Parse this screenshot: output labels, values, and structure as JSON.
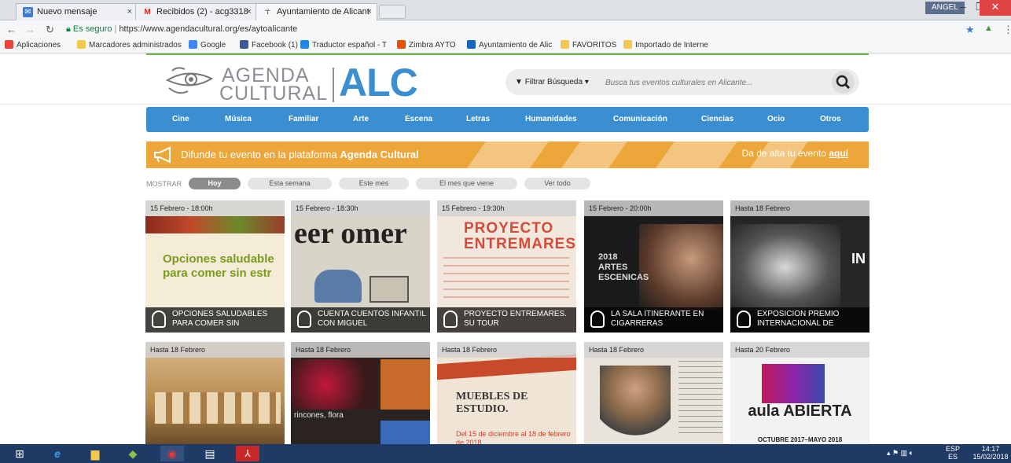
{
  "browser": {
    "tabs": [
      {
        "label": "Nuevo mensaje",
        "icon": "compose-icon",
        "close": "×"
      },
      {
        "label": "Recibidos (2) - acg3318",
        "icon": "gmail-icon",
        "close": "×"
      },
      {
        "label": "Ayuntamiento de Alicant",
        "icon": "alc-icon",
        "close": "×"
      }
    ],
    "user": "ANGEL",
    "secure_label": "Es seguro",
    "url": "https://www.agendacultural.org/es/aytoalicante",
    "bookmarks": [
      {
        "label": "Aplicaciones",
        "color": "#e8443a"
      },
      {
        "label": "Marcadores administrados",
        "color": "#f2c94c"
      },
      {
        "label": "Google",
        "color": "#4285f4"
      },
      {
        "label": "Facebook (1)",
        "color": "#3b5998"
      },
      {
        "label": "Traductor español - T",
        "color": "#1e88e5"
      },
      {
        "label": "Zimbra AYTO",
        "color": "#e65100"
      },
      {
        "label": "Ayuntamiento de Alic",
        "color": "#1565c0"
      },
      {
        "label": "FAVORITOS",
        "color": "#f2c94c"
      },
      {
        "label": "Importado de Interne",
        "color": "#f2c94c"
      }
    ]
  },
  "site": {
    "logo": {
      "agenda": "AGENDA",
      "cultural": "CULTURAL",
      "alc": "ALC"
    },
    "filter_label": "Filtrar Búsqueda",
    "search_placeholder": "Busca tus eventos culturales en Alicante...",
    "menu": [
      "Cine",
      "Música",
      "Familiar",
      "Arte",
      "Escena",
      "Letras",
      "Humanidades",
      "Comunicación",
      "Ciencias",
      "Ocio",
      "Otros"
    ],
    "banner": {
      "text": "Difunde tu evento en la plataforma ",
      "bold": "Agenda Cultural",
      "cta": "Da de alta tu evento ",
      "cta_link": "aquí"
    },
    "mostrar": "MOSTRAR",
    "filters": [
      "Hoy",
      "Esta semana",
      "Este mes",
      "El mes que viene",
      "Ver todo"
    ],
    "row1": [
      {
        "date": "15 Febrero - 18:00h",
        "title": "OPCIONES SALUDABLES PARA COMER SIN",
        "img_text": "Opciones saludable para comer sin estr",
        "bg": "#f4ecd6"
      },
      {
        "date": "15 Febrero - 18:30h",
        "title": "CUENTA CUENTOS INFANTIL CON MIGUEL",
        "img_text": "eer omer",
        "bg": "#d9d4c8"
      },
      {
        "date": "15 Febrero - 19:30h",
        "title": "PROYECTO ENTREMARES. SU TOUR",
        "img_text": "PROYECTO ENTREMARES",
        "bg": "#f1e7dc"
      },
      {
        "date": "15 Febrero - 20:00h",
        "title": "LA SALA ITINERANTE EN CIGARRERAS",
        "img_text": "2018 ARTES ESCENICAS",
        "bg": "#1b1b1b"
      },
      {
        "date": "Hasta 18 Febrero",
        "title": "EXPOSICIÓN PREMIO INTERNACIONAL DE",
        "img_text": "IN",
        "bg": "#262626"
      }
    ],
    "row2": [
      {
        "date": "Hasta 18 Febrero",
        "bg": "#b68a4e"
      },
      {
        "date": "Hasta 18 Febrero",
        "img_text": "rincones, flora",
        "bg": "#2a2320"
      },
      {
        "date": "Hasta 18 Febrero",
        "img_text": "MUEBLES DE ESTUDIO.",
        "sub": "Del 15 de diciembre al 18 de febrero de 2018",
        "bg": "#efe4d6"
      },
      {
        "date": "Hasta 18 Febrero",
        "bg": "#e8e4dc"
      },
      {
        "date": "Hasta 20 Febrero",
        "img_text": "aula ABIERTA",
        "sub": "OCTUBRE 2017–MAYO 2018",
        "bg": "#f2f2f0"
      }
    ]
  },
  "taskbar": {
    "lang": "ESP",
    "lang2": "ES",
    "time": "14:17",
    "date": "15/02/2018"
  },
  "colors": {
    "brand_blue": "#3b8fd1",
    "banner": "#eda63a",
    "taskbar": "#1f3a64"
  }
}
